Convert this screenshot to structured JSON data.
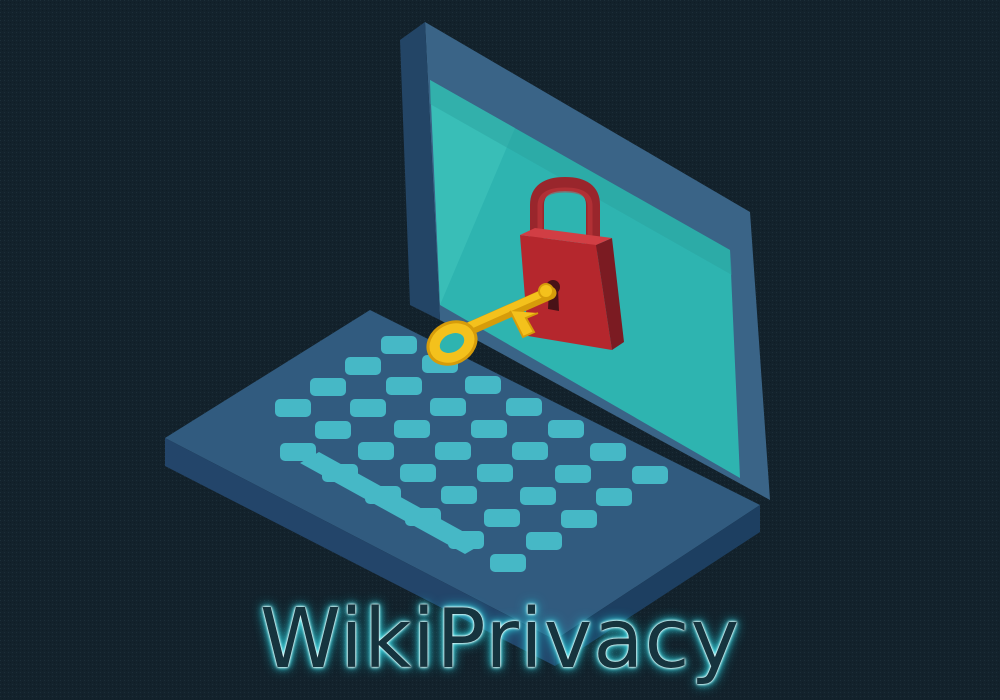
{
  "brand": {
    "title": "WikiPrivacy"
  },
  "colors": {
    "background": "#13222c",
    "laptop_body": "#315b7f",
    "laptop_edge": "#254869",
    "screen": "#2fb8b4",
    "keys": "#47bac8",
    "padlock": "#b5272d",
    "key": "#f4c11c",
    "title_glow": "#3ee8f2"
  },
  "icons": {
    "illustration": "laptop-icon",
    "lock": "padlock-icon",
    "key": "key-icon"
  }
}
